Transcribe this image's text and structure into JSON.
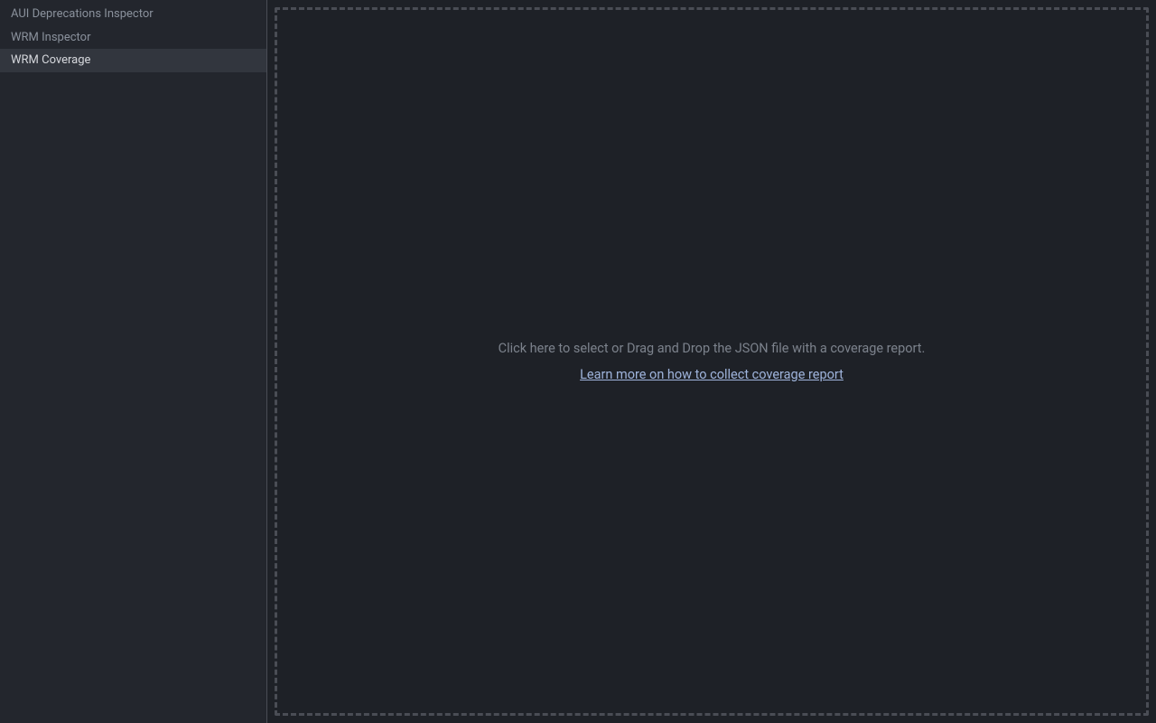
{
  "sidebar": {
    "items": [
      {
        "label": "AUI Deprecations Inspector",
        "active": false
      },
      {
        "label": "WRM Inspector",
        "active": false
      },
      {
        "label": "WRM Coverage",
        "active": true
      }
    ]
  },
  "main": {
    "dropzone": {
      "message": "Click here to select or Drag and Drop the JSON file with a coverage report.",
      "link_text": "Learn more on how to collect coverage report"
    }
  }
}
